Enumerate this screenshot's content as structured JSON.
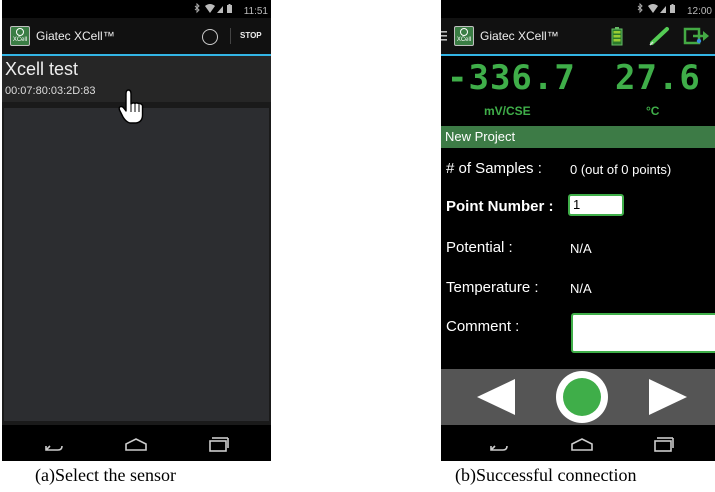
{
  "panel_a": {
    "status_time": "11:51",
    "app_title": "Giatec XCell™",
    "stop_label": "STOP",
    "device": {
      "name": "Xcell test",
      "mac": "00:07:80:03:2D:83"
    },
    "caption": "(a)Select the sensor"
  },
  "panel_b": {
    "status_time": "12:00",
    "app_title": "Giatec XCell™",
    "readings": [
      {
        "value": "-336.7",
        "unit": "mV/CSE"
      },
      {
        "value": "27.6",
        "unit": "°C"
      }
    ],
    "project_name": "New Project",
    "samples_label": "# of Samples :",
    "samples_value": "0 (out of 0 points)",
    "point_label": "Point Number :",
    "point_value": "1",
    "potential_label": "Potential :",
    "potential_value": "N/A",
    "temperature_label": "Temperature :",
    "temperature_value": "N/A",
    "comment_label": "Comment :",
    "caption": "(b)Successful connection"
  },
  "app_logo_text": "XCell",
  "colors": {
    "accent_green": "#3fae49",
    "project_bar": "#3d7b46",
    "holo_blue": "#33b5e5"
  },
  "icons": [
    "bluetooth-icon",
    "wifi-icon",
    "signal-icon",
    "battery-icon",
    "spinner-icon",
    "menu-icon",
    "battery-full-icon",
    "probe-icon",
    "usb-export-icon",
    "previous-arrow-icon",
    "record-icon",
    "next-arrow-icon",
    "back-icon",
    "home-icon",
    "recent-apps-icon",
    "hand-cursor-icon"
  ]
}
